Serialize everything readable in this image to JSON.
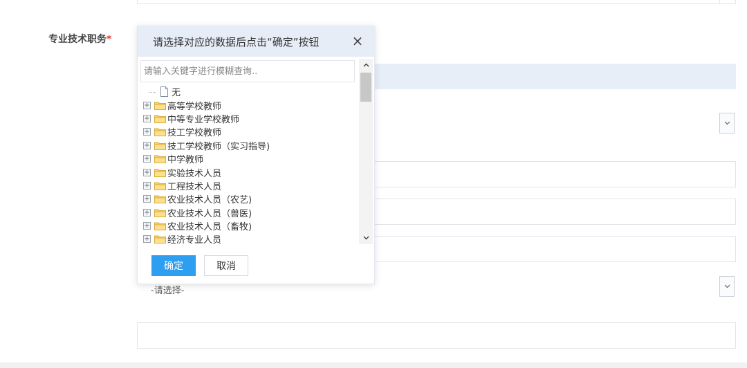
{
  "form": {
    "field_label": "专业技术职务",
    "required_mark": "*",
    "select_placeholder": "-请选择-"
  },
  "dialog": {
    "title": "请选择对应的数据后点击“确定”按钮",
    "close_glyph": "×",
    "search_placeholder": "请输入关键字进行模糊查询..",
    "tree": {
      "none_label": "无",
      "expander_glyph": "+",
      "items": [
        "高等学校教师",
        "中等专业学校教师",
        "技工学校教师",
        "技工学校教师（实习指导)",
        "中学教师",
        "实验技术人员",
        "工程技术人员",
        "农业技术人员（农艺)",
        "农业技术人员（兽医)",
        "农业技术人员（畜牧)",
        "经济专业人员"
      ]
    },
    "ok_label": "确定",
    "cancel_label": "取消"
  },
  "colors": {
    "accent": "#2d9ef0",
    "header_bg": "#e6edf7",
    "required": "#e53935"
  }
}
